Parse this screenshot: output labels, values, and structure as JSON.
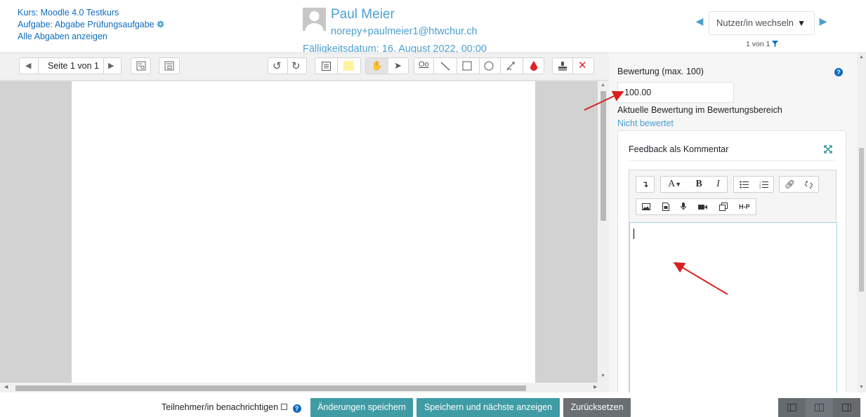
{
  "header": {
    "course": "Kurs: Moodle 4.0 Testkurs",
    "assignment": "Aufgabe: Abgabe Prüfungsaufgabe",
    "all_submissions": "Alle Abgaben anzeigen",
    "user_name": "Paul Meier",
    "user_email": "norepy+paulmeier1@htwchur.ch",
    "due_date": "Fälligkeitsdatum: 16. August 2022, 00:00",
    "switch_user": "Nutzer/in wechseln",
    "counter": "1 von 1"
  },
  "toolbar": {
    "page_label": "Seite 1 von 1",
    "icons": [
      "prev-page-icon",
      "next-page-icon",
      "search-comments-icon",
      "expand-comments-icon",
      "rotate-left-icon",
      "rotate-right-icon",
      "comment-icon",
      "highlight-color-icon",
      "pan-icon",
      "select-icon",
      "oval-icon",
      "line-icon",
      "rectangle-icon",
      "circle-icon",
      "pen-icon",
      "red-drop-icon",
      "stamp-icon",
      "delete-icon"
    ]
  },
  "grade": {
    "label": "Bewertung (max. 100)",
    "value": "100.00",
    "current_label": "Aktuelle Bewertung im Bewertungsbereich",
    "current_value": "Nicht bewertet"
  },
  "feedback": {
    "title": "Feedback als Kommentar",
    "editor_buttons": [
      "collapse",
      "font",
      "bold",
      "italic",
      "unordered-list",
      "ordered-list",
      "link",
      "unlink",
      "image",
      "media",
      "record-audio",
      "record-video",
      "manage-files",
      "h5p"
    ],
    "labels": {
      "font": "A",
      "bold": "B",
      "italic": "I",
      "h5p": "H-P"
    }
  },
  "footer": {
    "notify_label": "Teilnehmer/in benachrichtigen",
    "save": "Änderungen speichern",
    "save_next": "Speichern und nächste anzeigen",
    "reset": "Zurücksetzen"
  },
  "colors": {
    "link": "#4a9fd0",
    "teal_button": "#3f9ca5",
    "grey_button": "#6a6f73",
    "delete_red": "#e02424",
    "annotation_arrow": "#d92020",
    "help_blue": "#0f6cbf"
  }
}
